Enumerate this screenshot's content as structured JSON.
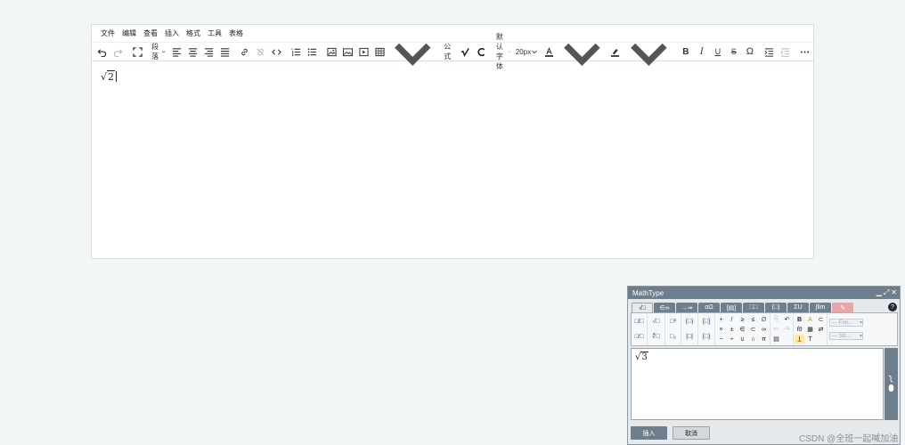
{
  "menu": [
    "文件",
    "编辑",
    "查看",
    "插入",
    "格式",
    "工具",
    "表格"
  ],
  "toolbar": {
    "paragraph": "段落",
    "formula": "公式",
    "font_family": "默认字体",
    "font_size": "20px"
  },
  "editor": {
    "content_radicand": "2"
  },
  "mathtype": {
    "title": "MathType",
    "window_controls": [
      "▁",
      "⤢",
      "✕"
    ],
    "tabs": [
      "√□",
      "∈∞",
      "→⇒",
      "αΩ",
      "[▤]",
      "□□",
      "(□)",
      "ΣU",
      "∫lim",
      "✎"
    ],
    "help": "?",
    "font_select": "--- Fon...",
    "size_select": "--- Siz...",
    "input_radicand": "3",
    "insert_label": "插入",
    "cancel_label": "取消",
    "symbols_row1": [
      "+",
      "/",
      "≥",
      "≤",
      "∅"
    ],
    "symbols_row2": [
      "×",
      "±",
      "∈",
      "⊂",
      "∞"
    ],
    "symbols_row3": [
      "−",
      "÷",
      "∪",
      "∩",
      "π"
    ]
  },
  "watermark": "CSDN @全班一起喊加油"
}
